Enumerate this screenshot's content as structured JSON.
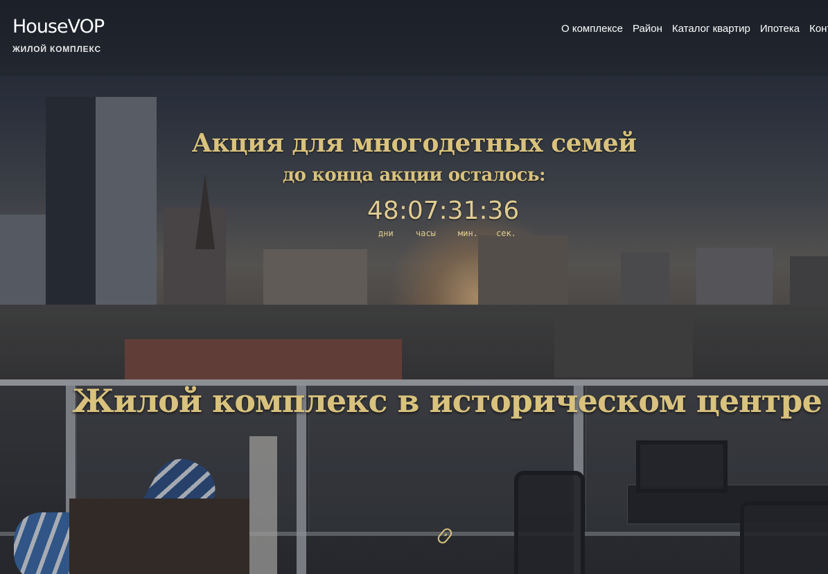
{
  "header": {
    "logo_name": "HouseVOP",
    "logo_subtitle": "ЖИЛОЙ КОМПЛЕКС",
    "nav": [
      "О комплексе",
      "Район",
      "Каталог квартир",
      "Ипотека",
      "Контакты"
    ]
  },
  "promo": {
    "title": "Акция для многодетных семей",
    "subtitle": "до конца акции осталось:",
    "countdown": {
      "days": "48",
      "hours": "07",
      "minutes": "31",
      "seconds": "36",
      "separator": ":",
      "labels": {
        "days": "дни",
        "hours": "часы",
        "minutes": "мин.",
        "seconds": "сек."
      }
    }
  },
  "hero": {
    "title": "Жилой комплекс в историческом центре"
  },
  "colors": {
    "accent_gold": "#d9c27d",
    "nav_text": "#ffffff"
  },
  "icons": {
    "scroll": "scroll-down-icon"
  }
}
